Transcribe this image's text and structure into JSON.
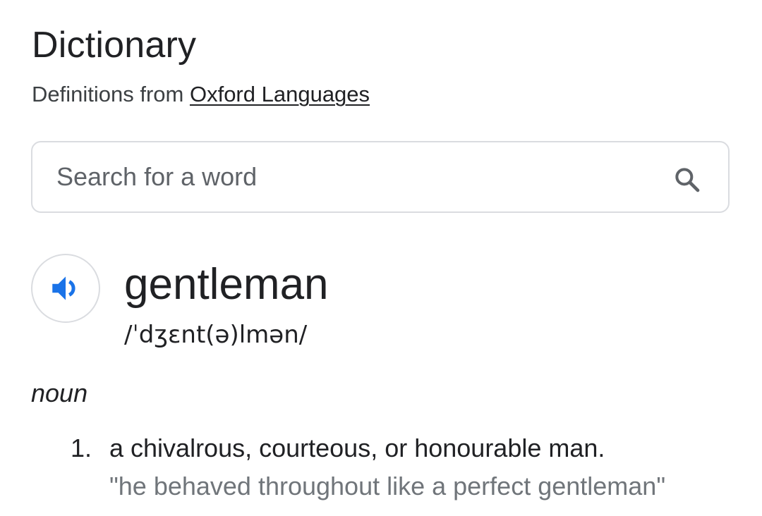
{
  "header": {
    "title": "Dictionary",
    "source_prefix": "Definitions from ",
    "source_link": "Oxford Languages"
  },
  "search": {
    "placeholder": "Search for a word",
    "value": "",
    "icon": "search-icon"
  },
  "entry": {
    "audio_icon": "speaker-icon",
    "word": "gentleman",
    "phonetic": "/ˈdʒɛnt(ə)lmən/",
    "part_of_speech": "noun",
    "definitions": [
      {
        "number": "1.",
        "text": "a chivalrous, courteous, or honourable man.",
        "example": "\"he behaved throughout like a perfect gentleman\""
      }
    ]
  },
  "colors": {
    "text": "#202124",
    "secondary_text": "#5f6368",
    "example_text": "#70757a",
    "border": "#dadce0",
    "accent": "#1a73e8"
  }
}
